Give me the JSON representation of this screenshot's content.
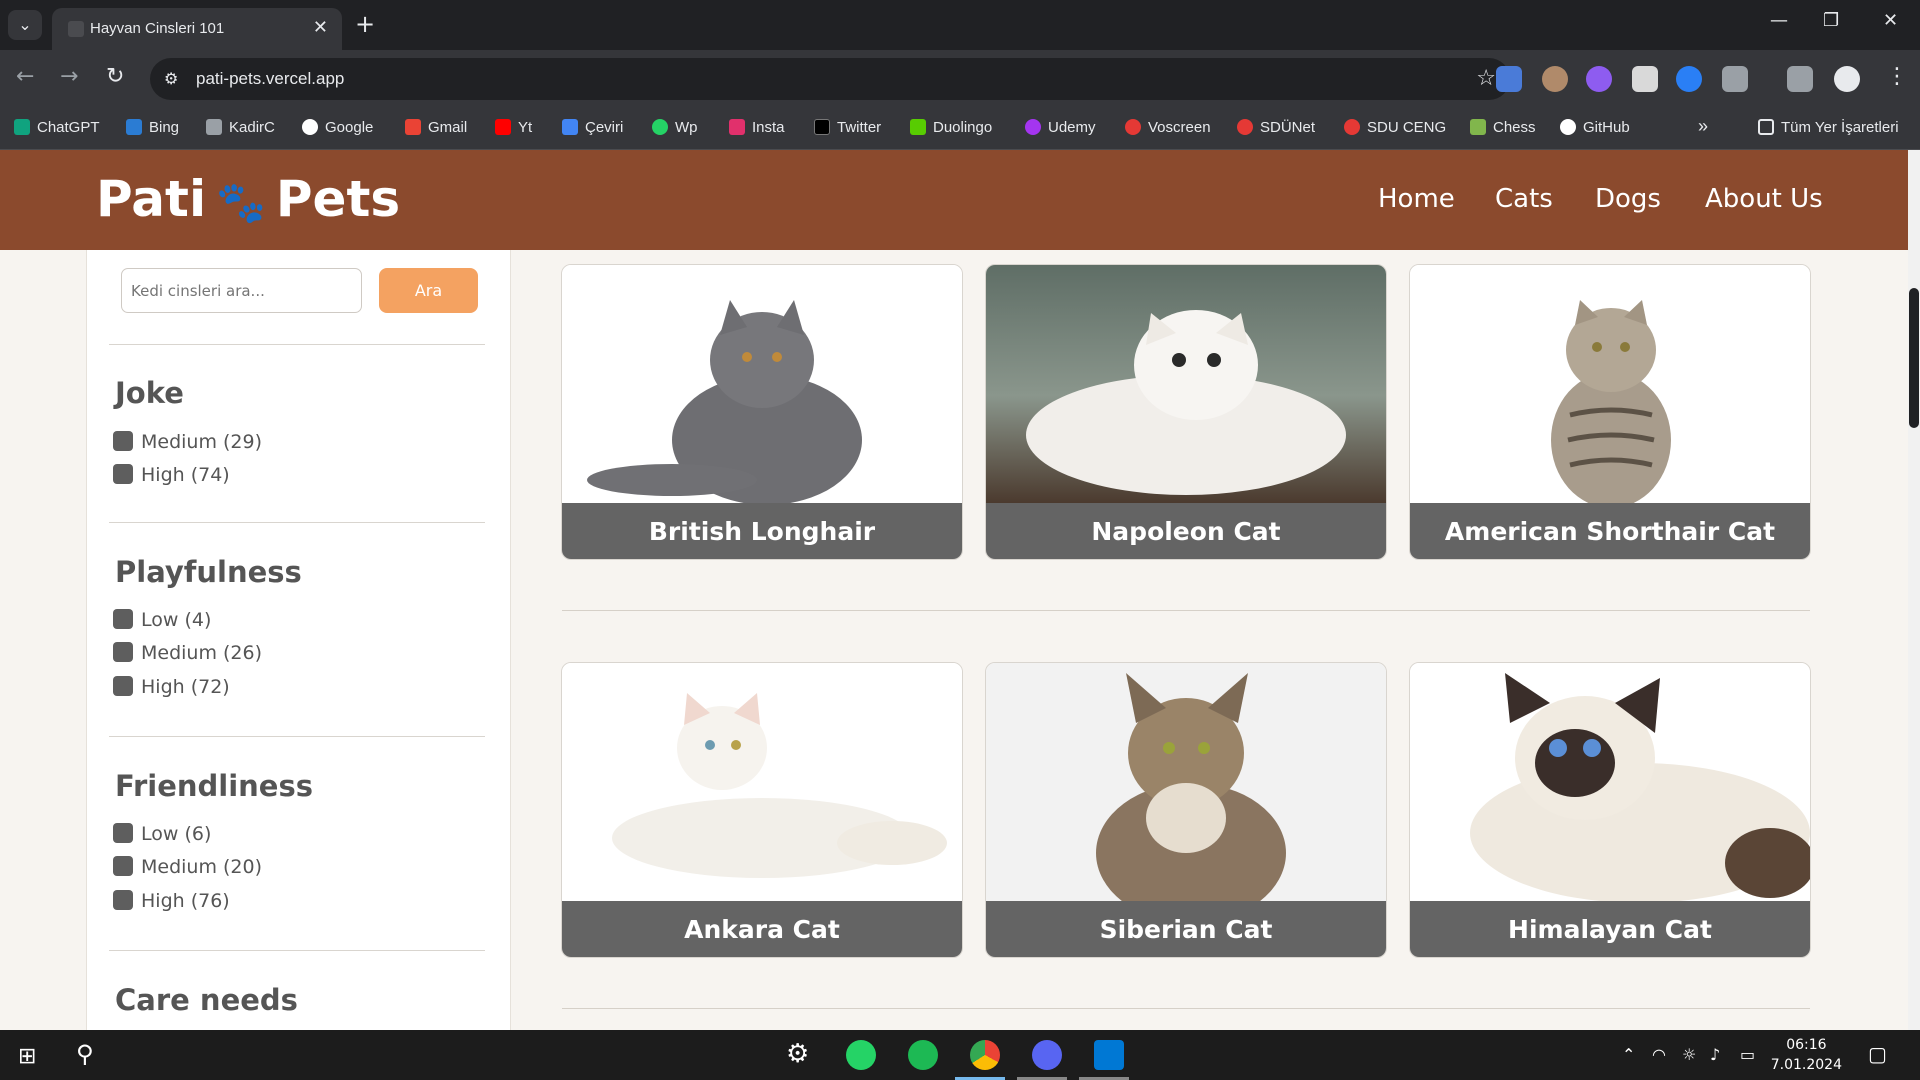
{
  "browser": {
    "tab_title": "Hayvan Cinsleri 101",
    "url": "pati-pets.vercel.app",
    "bookmarks": [
      {
        "label": "ChatGPT",
        "color": "#10a37f"
      },
      {
        "label": "Bing",
        "color": "#2b7cd3"
      },
      {
        "label": "KadirC",
        "color": "#9aa0a6"
      },
      {
        "label": "Google",
        "color": "#ffffff"
      },
      {
        "label": "Gmail",
        "color": "#ea4335"
      },
      {
        "label": "Yt",
        "color": "#ff0000"
      },
      {
        "label": "Çeviri",
        "color": "#4285f4"
      },
      {
        "label": "Wp",
        "color": "#25d366"
      },
      {
        "label": "Insta",
        "color": "#e1306c"
      },
      {
        "label": "Twitter",
        "color": "#000000"
      },
      {
        "label": "Duolingo",
        "color": "#58cc02"
      },
      {
        "label": "Udemy",
        "color": "#a435f0"
      },
      {
        "label": "Voscreen",
        "color": "#e53935"
      },
      {
        "label": "SDÜNet",
        "color": "#e53935"
      },
      {
        "label": "SDU CENG",
        "color": "#e53935"
      },
      {
        "label": "Chess",
        "color": "#81b64c"
      },
      {
        "label": "GitHub",
        "color": "#ffffff"
      }
    ],
    "more": "»",
    "all_bookmarks": "Tüm Yer İşaretleri"
  },
  "site": {
    "logo_left": "Pati",
    "logo_paw": "🐾",
    "logo_right": "Pets",
    "nav": [
      "Home",
      "Cats",
      "Dogs",
      "About Us"
    ]
  },
  "sidebar": {
    "search_placeholder": "Kedi cinsleri ara...",
    "search_button": "Ara",
    "filters": [
      {
        "title": "Joke",
        "options": [
          "Medium (29)",
          "High (74)"
        ]
      },
      {
        "title": "Playfulness",
        "options": [
          "Low (4)",
          "Medium (26)",
          "High (72)"
        ]
      },
      {
        "title": "Friendliness",
        "options": [
          "Low (6)",
          "Medium (20)",
          "High (76)"
        ]
      },
      {
        "title": "Care needs",
        "options": []
      }
    ]
  },
  "cards": [
    {
      "name": "British Longhair",
      "bg": "#ffffff",
      "cat": "#6e6e72"
    },
    {
      "name": "Napoleon Cat",
      "bg": "#6f7c72",
      "cat": "#f4f2ee"
    },
    {
      "name": "American Shorthair Cat",
      "bg": "#ffffff",
      "cat": "#a89c8c"
    },
    {
      "name": "Ankara Cat",
      "bg": "#ffffff",
      "cat": "#f2efe9"
    },
    {
      "name": "Siberian Cat",
      "bg": "#f2f2f2",
      "cat": "#8a7560"
    },
    {
      "name": "Himalayan Cat",
      "bg": "#ffffff",
      "cat": "#efe9df"
    }
  ],
  "taskbar": {
    "time": "06:16",
    "date": "7.01.2024"
  }
}
